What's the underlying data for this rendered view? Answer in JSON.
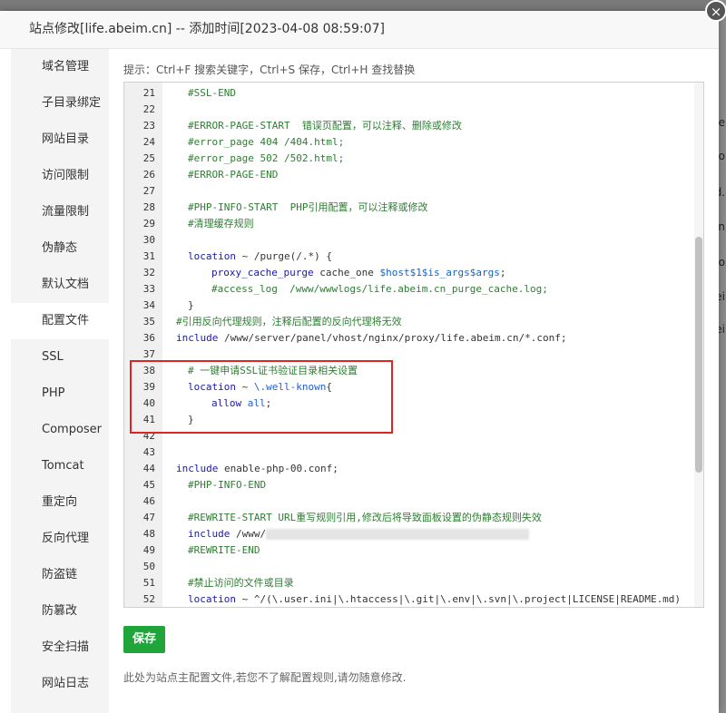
{
  "dialog": {
    "title": "站点修改[life.abeim.cn] -- 添加时间[2023-04-08 08:59:07]",
    "close_symbol": "×"
  },
  "background": [
    "be",
    "o",
    "d.",
    "n",
    "o",
    "ei",
    "ei"
  ],
  "sidebar": {
    "items": [
      {
        "label": "域名管理"
      },
      {
        "label": "子目录绑定"
      },
      {
        "label": "网站目录"
      },
      {
        "label": "访问限制"
      },
      {
        "label": "流量限制"
      },
      {
        "label": "伪静态"
      },
      {
        "label": "默认文档"
      },
      {
        "label": "配置文件"
      },
      {
        "label": "SSL"
      },
      {
        "label": "PHP"
      },
      {
        "label": "Composer"
      },
      {
        "label": "Tomcat"
      },
      {
        "label": "重定向"
      },
      {
        "label": "反向代理"
      },
      {
        "label": "防盗链"
      },
      {
        "label": "防篡改"
      },
      {
        "label": "安全扫描"
      },
      {
        "label": "网站日志"
      }
    ],
    "active": "配置文件"
  },
  "tip": "提示：Ctrl+F 搜索关键字，Ctrl+S 保存，Ctrl+H 查找替换",
  "editor": {
    "lines": [
      {
        "n": "21",
        "indent": 1,
        "parts": [
          {
            "t": "#SSL-END",
            "c": "c-comment"
          }
        ]
      },
      {
        "n": "22",
        "indent": 1,
        "parts": []
      },
      {
        "n": "23",
        "indent": 1,
        "parts": [
          {
            "t": "#ERROR-PAGE-START  错误页配置，可以注释、删除或修改",
            "c": "c-comment"
          }
        ]
      },
      {
        "n": "24",
        "indent": 1,
        "parts": [
          {
            "t": "#error_page 404 /404.html;",
            "c": "c-comment"
          }
        ]
      },
      {
        "n": "25",
        "indent": 1,
        "parts": [
          {
            "t": "#error_page 502 /502.html;",
            "c": "c-comment"
          }
        ]
      },
      {
        "n": "26",
        "indent": 1,
        "parts": [
          {
            "t": "#ERROR-PAGE-END",
            "c": "c-comment"
          }
        ]
      },
      {
        "n": "27",
        "indent": 1,
        "parts": []
      },
      {
        "n": "28",
        "indent": 1,
        "parts": [
          {
            "t": "#PHP-INFO-START  PHP引用配置，可以注释或修改",
            "c": "c-comment"
          }
        ]
      },
      {
        "n": "29",
        "indent": 1,
        "parts": [
          {
            "t": "#清理缓存规则",
            "c": "c-comment"
          }
        ]
      },
      {
        "n": "30",
        "indent": 1,
        "parts": []
      },
      {
        "n": "31",
        "indent": 1,
        "parts": [
          {
            "t": "location",
            "c": "c-kw"
          },
          {
            "t": " ~ /purge(/.*) {",
            "c": "c-plain"
          }
        ]
      },
      {
        "n": "32",
        "indent": 2,
        "parts": [
          {
            "t": "proxy_cache_purge",
            "c": "c-kw"
          },
          {
            "t": " cache_one ",
            "c": "c-plain"
          },
          {
            "t": "$host$1$is_args$args",
            "c": "c-var"
          },
          {
            "t": ";",
            "c": "c-plain"
          }
        ]
      },
      {
        "n": "33",
        "indent": 2,
        "parts": [
          {
            "t": "#access_log  /www/wwwlogs/life.abeim.cn_purge_cache.log;",
            "c": "c-comment"
          }
        ]
      },
      {
        "n": "34",
        "indent": 1,
        "parts": [
          {
            "t": "}",
            "c": "c-plain"
          }
        ]
      },
      {
        "n": "35",
        "indent": 0,
        "parts": [
          {
            "t": "#引用反向代理规则，注释后配置的反向代理将无效",
            "c": "c-comment"
          }
        ]
      },
      {
        "n": "36",
        "indent": 0,
        "parts": [
          {
            "t": "include",
            "c": "c-kw"
          },
          {
            "t": " /www/server/panel/vhost/nginx/proxy/life.abeim.cn/*.conf;",
            "c": "c-plain"
          }
        ]
      },
      {
        "n": "37",
        "indent": 0,
        "parts": []
      },
      {
        "n": "38",
        "indent": 1,
        "parts": [
          {
            "t": "# 一键申请SSL证书验证目录相关设置",
            "c": "c-comment"
          }
        ]
      },
      {
        "n": "39",
        "indent": 1,
        "parts": [
          {
            "t": "location",
            "c": "c-kw"
          },
          {
            "t": " ~ ",
            "c": "c-plain"
          },
          {
            "t": "\\.well-known",
            "c": "c-blue"
          },
          {
            "t": "{",
            "c": "c-plain"
          }
        ]
      },
      {
        "n": "40",
        "indent": 2,
        "parts": [
          {
            "t": "allow",
            "c": "c-kw"
          },
          {
            "t": " ",
            "c": "c-plain"
          },
          {
            "t": "all",
            "c": "c-blue"
          },
          {
            "t": ";",
            "c": "c-plain"
          }
        ]
      },
      {
        "n": "41",
        "indent": 1,
        "parts": [
          {
            "t": "}",
            "c": "c-plain"
          }
        ]
      },
      {
        "n": "42",
        "indent": 0,
        "parts": []
      },
      {
        "n": "43",
        "indent": 0,
        "parts": []
      },
      {
        "n": "44",
        "indent": 0,
        "parts": [
          {
            "t": "include",
            "c": "c-kw"
          },
          {
            "t": " enable-php-00.conf;",
            "c": "c-plain"
          }
        ]
      },
      {
        "n": "45",
        "indent": 1,
        "parts": [
          {
            "t": "#PHP-INFO-END",
            "c": "c-comment"
          }
        ]
      },
      {
        "n": "46",
        "indent": 1,
        "parts": []
      },
      {
        "n": "47",
        "indent": 1,
        "parts": [
          {
            "t": "#REWRITE-START URL重写规则引用,修改后将导致面板设置的伪静态规则失效",
            "c": "c-comment"
          }
        ]
      },
      {
        "n": "48",
        "indent": 1,
        "parts": [
          {
            "t": "include",
            "c": "c-kw"
          },
          {
            "t": " /www/",
            "c": "c-plain"
          },
          {
            "t": "",
            "c": "blurred"
          }
        ]
      },
      {
        "n": "49",
        "indent": 1,
        "parts": [
          {
            "t": "#REWRITE-END",
            "c": "c-comment"
          }
        ]
      },
      {
        "n": "50",
        "indent": 1,
        "parts": []
      },
      {
        "n": "51",
        "indent": 1,
        "parts": [
          {
            "t": "#禁止访问的文件或目录",
            "c": "c-comment"
          }
        ]
      },
      {
        "n": "52",
        "indent": 1,
        "parts": [
          {
            "t": "location",
            "c": "c-kw"
          },
          {
            "t": " ~ ^/(\\.user.ini|\\.htaccess|\\.git|\\.env|\\.svn|\\.project|LICENSE|README.md)",
            "c": "c-plain"
          }
        ]
      }
    ]
  },
  "save_label": "保存",
  "note": "此处为站点主配置文件,若您不了解配置规则,请勿随意修改."
}
